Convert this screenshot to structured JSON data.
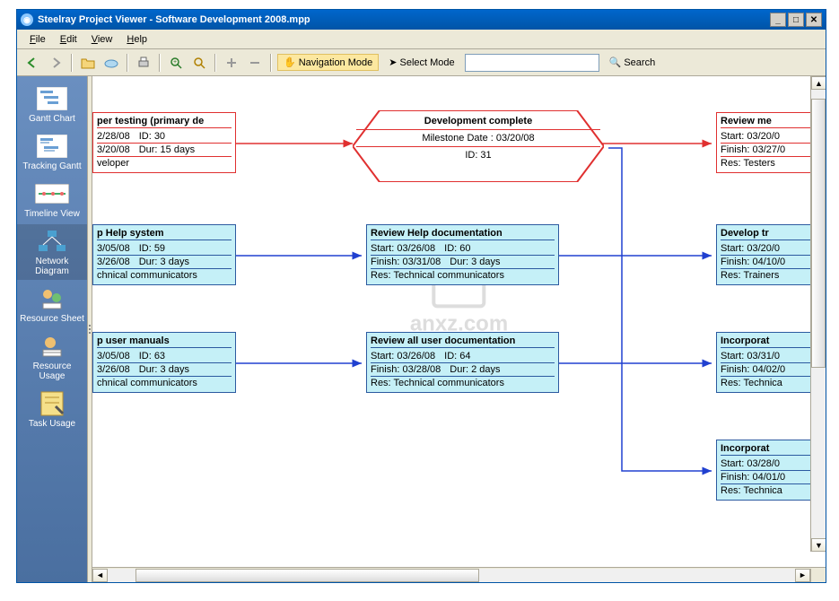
{
  "window": {
    "title": "Steelray Project Viewer - Software Development 2008.mpp"
  },
  "menu": {
    "file": "File",
    "edit": "Edit",
    "view": "View",
    "help": "Help"
  },
  "toolbar": {
    "nav_mode": "Navigation Mode",
    "select_mode": "Select Mode",
    "search_label": "Search",
    "search_value": ""
  },
  "sidebar": {
    "items": [
      {
        "label": "Gantt Chart"
      },
      {
        "label": "Tracking Gantt"
      },
      {
        "label": "Timeline View"
      },
      {
        "label": "Network Diagram"
      },
      {
        "label": "Resource Sheet"
      },
      {
        "label": "Resource Usage"
      },
      {
        "label": "Task Usage"
      }
    ]
  },
  "nodes": {
    "n1": {
      "title": "per testing (primary de",
      "r1a": "2/28/08",
      "r1b": "ID:   30",
      "r2a": "3/20/08",
      "r2b": "Dur: 15 days",
      "r3": "veloper"
    },
    "milestone": {
      "title": "Development complete",
      "date": "Milestone Date : 03/20/08",
      "id": "ID: 31"
    },
    "n2": {
      "title": "Review me",
      "r1": "Start:  03/20/0",
      "r2": "Finish: 03/27/0",
      "r3": "Res: Testers"
    },
    "n3": {
      "title": "p Help system",
      "r1a": "3/05/08",
      "r1b": "ID:   59",
      "r2a": "3/26/08",
      "r2b": "Dur: 3 days",
      "r3": "chnical communicators"
    },
    "n4": {
      "title": "Review Help documentation",
      "r1a": "Start:  03/26/08",
      "r1b": "ID:   60",
      "r2a": "Finish: 03/31/08",
      "r2b": "Dur: 3 days",
      "r3": "Res: Technical communicators"
    },
    "n5": {
      "title": "Develop tr",
      "r1": "Start:  03/20/0",
      "r2": "Finish: 04/10/0",
      "r3": "Res: Trainers"
    },
    "n6": {
      "title": "p user manuals",
      "r1a": "3/05/08",
      "r1b": "ID:   63",
      "r2a": "3/26/08",
      "r2b": "Dur: 3 days",
      "r3": "chnical communicators"
    },
    "n7": {
      "title": "Review all user documentation",
      "r1a": "Start:  03/26/08",
      "r1b": "ID:   64",
      "r2a": "Finish: 03/28/08",
      "r2b": "Dur: 2 days",
      "r3": "Res: Technical communicators"
    },
    "n8": {
      "title": "Incorporat",
      "r1": "Start:  03/31/0",
      "r2": "Finish: 04/02/0",
      "r3": "Res: Technica"
    },
    "n9": {
      "title": "Incorporat",
      "r1": "Start:  03/28/0",
      "r2": "Finish: 04/01/0",
      "r3": "Res: Technica"
    }
  },
  "watermark": "anxz.com"
}
